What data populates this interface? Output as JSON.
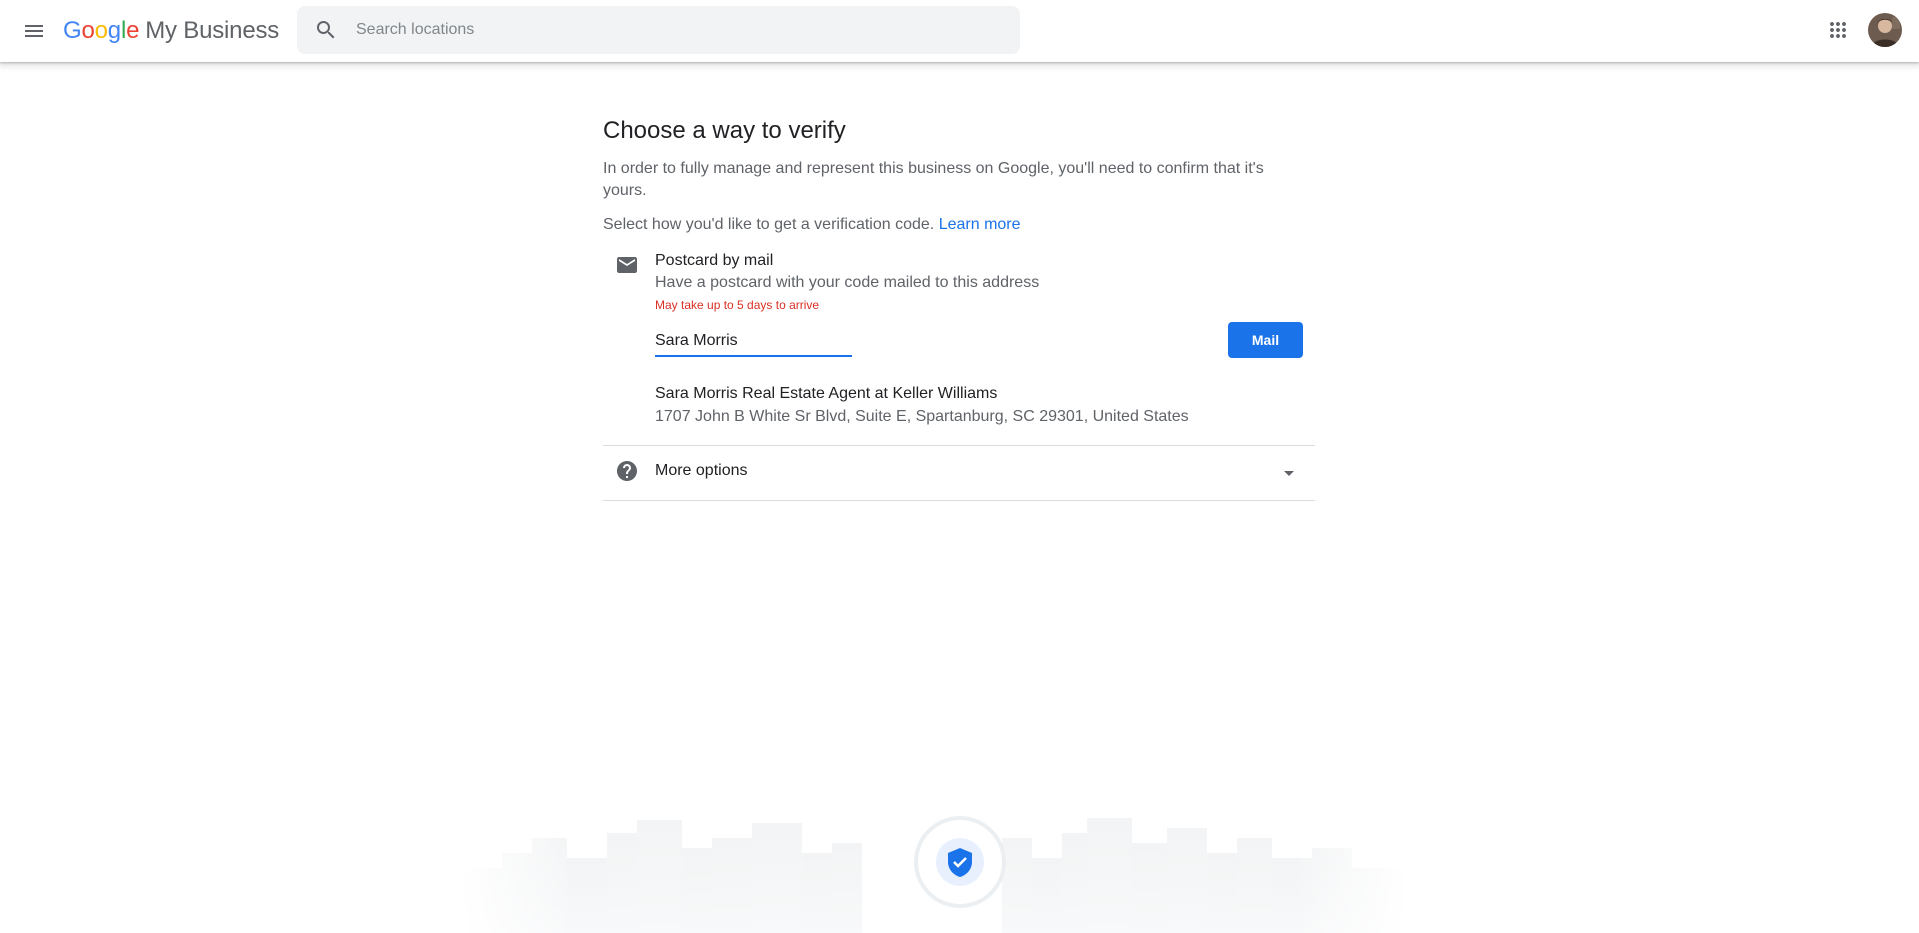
{
  "header": {
    "brand_google": [
      "G",
      "o",
      "o",
      "g",
      "l",
      "e"
    ],
    "brand_product": "My Business",
    "search_placeholder": "Search locations",
    "icons": {
      "menu": "menu-icon",
      "search": "search-icon",
      "apps": "apps-grid-icon",
      "avatar": "avatar"
    }
  },
  "main": {
    "title": "Choose a way to verify",
    "intro": "In order to fully manage and represent this business on Google, you'll need to confirm that it's yours.",
    "select_text": "Select how you'd like to get a verification code.",
    "learn_more": "Learn more",
    "postcard": {
      "icon": "mail-icon",
      "title": "Postcard by mail",
      "description": "Have a postcard with your code mailed to this address",
      "warning": "May take up to 5 days to arrive",
      "name_value": "Sara Morris",
      "button_label": "Mail",
      "business_name": "Sara Morris Real Estate Agent at Keller Williams",
      "business_address": "1707 John B White Sr Blvd, Suite E, Spartanburg, SC 29301, United States"
    },
    "more_options": {
      "icon": "help-icon",
      "label": "More options",
      "caret": "caret-down-icon"
    }
  },
  "colors": {
    "accent": "#1a73e8",
    "warning": "#d93025",
    "text_primary": "#202124",
    "text_secondary": "#5f6368",
    "search_bg": "#f1f3f4"
  }
}
